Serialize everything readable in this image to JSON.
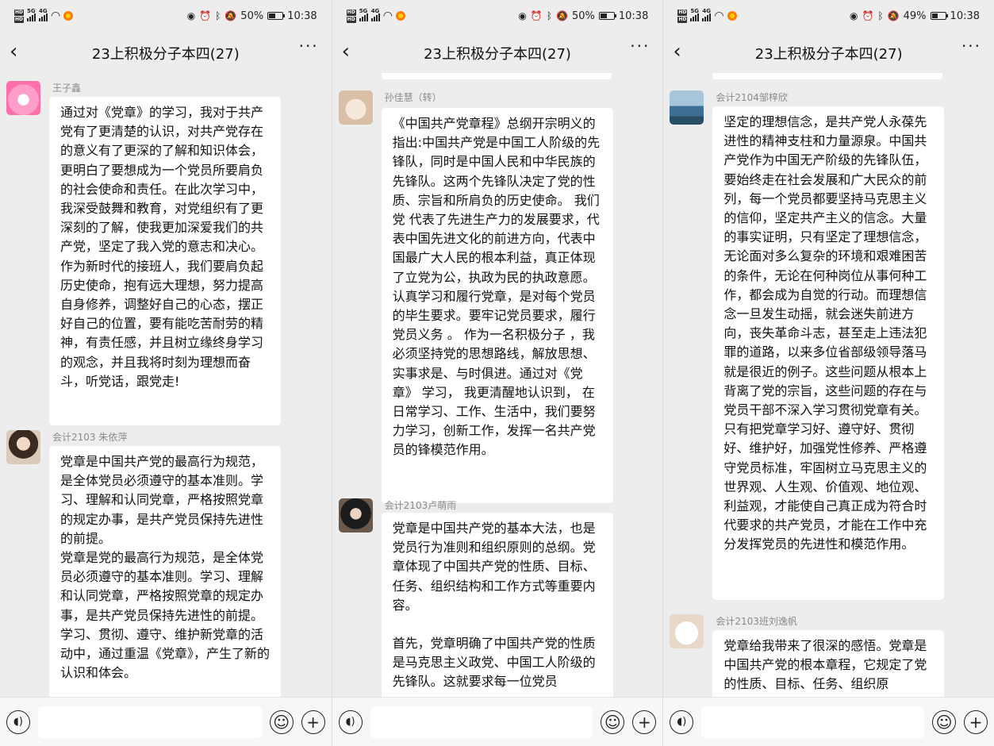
{
  "colors": {
    "background": "#ededed",
    "bubble": "#ffffff",
    "sender_text": "#8a8a8a"
  },
  "screens": [
    {
      "status": {
        "battery": "50%",
        "time": "10:38",
        "battery_level": 0.5
      },
      "header": {
        "title": "23上积极分子本四(27)"
      },
      "messages": [
        {
          "sender": "王子鑫",
          "avatar_icon": "pink-character-avatar",
          "paragraphs": [
            "通过对《党章》的学习，我对于共产党有了更清楚的认识，对共产党存在的意义有了更深的了解和知识体会，更明白了要想成为一个党员所要肩负的社会使命和责任。在此次学习中，我深受鼓舞和教育，对党组织有了更深刻的了解，使我更加深爱我们的共产党，坚定了我入党的意志和决心。作为新时代的接班人，我们要肩负起历史使命，抱有远大理想，努力提高自身修养，调整好自己的心态，摆正好自己的位置，要有能吃苦耐劳的精神，有责任感，并且树立缘终身学习的观念，并且我将时刻为理想而奋斗，听党话，跟党走!"
          ]
        },
        {
          "sender": "会计2103 朱依萍",
          "avatar_icon": "girl-sunglasses-avatar",
          "paragraphs": [
            "党章是中国共产党的最高行为规范，是全体党员必须遵守的基本准则。学习、理解和认同党章，严格按照党章的规定办事，是共产党员保持先进性的前提。",
            "党章是党的最高行为规范，是全体党员必须遵守的基本准则。学习、理解和认同党章，严格按照党章的规定办事，是共产党员保持先进性的前提。",
            "学习、贯彻、遵守、维护新党章的活动中，通过重温《党章》，产生了新的认识和体会。"
          ]
        }
      ]
    },
    {
      "status": {
        "battery": "50%",
        "time": "10:38",
        "battery_level": 0.5
      },
      "header": {
        "title": "23上积极分子本四(27)"
      },
      "messages": [
        {
          "sender": "孙佳慧（转）",
          "avatar_icon": "cat-avatar",
          "paragraphs": [
            "《中国共产党章程》总纲开宗明义的指出:中国共产党是中国工人阶级的先锋队，同时是中国人民和中华民族的先锋队。这两个先锋队决定了党的性质、宗旨和所肩负的历史使命。 我们党 代表了先进生产力的发展要求，代表中国先进文化的前进方向，代表中国最广大人民的根本利益，真正体现了立党为公，执政为民的执政意愿。认真学习和履行党章，是对每个党员的毕生要求。要牢记党员要求，履行党员义务 。 作为一名积极分子 ，我必须坚持党的思想路线，解放思想、实事求是、与时俱进。通过对《党章》 学习， 我更清醒地认识到， 在日常学习、工作、生活中，我们要努力学习，创新工作，发挥一名共产党员的锋模范作用。"
          ]
        },
        {
          "sender": "会计2103卢萌雨",
          "avatar_icon": "girl-portrait-avatar",
          "paragraphs": [
            "党章是中国共产党的基本大法，也是党员行为准则和组织原则的总纲。党章体现了中国共产党的性质、目标、任务、组织结构和工作方式等重要内容。",
            "首先，党章明确了中国共产党的性质是马克思主义政党、中国工人阶级的先锋队。这就要求每一位党员"
          ]
        }
      ]
    },
    {
      "status": {
        "battery": "49%",
        "time": "10:38",
        "battery_level": 0.49
      },
      "header": {
        "title": "23上积极分子本四(27)"
      },
      "messages": [
        {
          "sender": "会计2104邹梓欣",
          "avatar_icon": "seaside-avatar",
          "paragraphs": [
            "坚定的理想信念，是共产党人永葆先进性的精神支柱和力量源泉。中国共产党作为中国无产阶级的先锋队伍，要始终走在社会发展和广大民众的前列，每一个党员都要坚持马克思主义的信仰，坚定共产主义的信念。大量的事实证明，只有坚定了理想信念，无论面对多么复杂的环境和艰难困苦的条件，无论在何种岗位从事何种工作，都会成为自觉的行动。而理想信念一旦发生动摇，就会迷失前进方向，丧失革命斗志，甚至走上违法犯罪的道路，以来多位省部级领导落马就是很近的例子。这些问题从根本上背离了党的宗旨，这些问题的存在与党员干部不深入学习贯彻党章有关。只有把党章学习好、遵守好、贯彻好、维护好，加强党性修养、严格遵守党员标准，牢固树立马克思主义的世界观、人生观、价值观、地位观、利益观，才能使自己真正成为符合时代要求的共产党员，才能在工作中充分发挥党员的先进性和模范作用。"
          ]
        },
        {
          "sender": "会计2103班刘逸帆",
          "avatar_icon": "white-cat-avatar",
          "paragraphs": [
            "党章给我带来了很深的感悟。党章是中国共产党的根本章程，它规定了党的性质、目标、任务、组织原"
          ]
        }
      ]
    }
  ]
}
